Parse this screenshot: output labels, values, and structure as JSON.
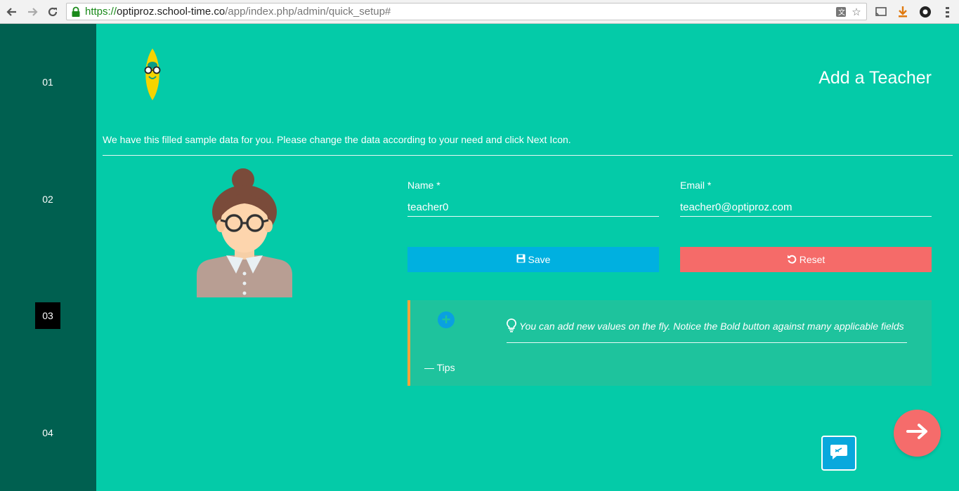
{
  "browser": {
    "url_scheme": "https://",
    "url_host": "optiproz.school-time.co",
    "url_path": "/app/index.php/admin/quick_setup#"
  },
  "sidebar": {
    "steps": [
      {
        "label": "01",
        "active": false
      },
      {
        "label": "02",
        "active": false
      },
      {
        "label": "03",
        "active": true
      },
      {
        "label": "04",
        "active": false
      }
    ]
  },
  "header": {
    "title": "Add a Teacher"
  },
  "intro_text": "We have this filled sample data for you. Please change the data according to your need and click Next Icon.",
  "form": {
    "name_label": "Name *",
    "name_value": "teacher0",
    "email_label": "Email *",
    "email_value": "teacher0@optiproz.com",
    "save_label": "Save",
    "reset_label": "Reset"
  },
  "tips": {
    "cite": "— Tips",
    "text": "You can add new values on the fly. Notice the Bold button against many applicable fields"
  },
  "colors": {
    "background": "#04cba8",
    "sidebar": "#006050",
    "save": "#00b0e0",
    "reset": "#f56b69",
    "tips_accent": "#f7a33b"
  }
}
